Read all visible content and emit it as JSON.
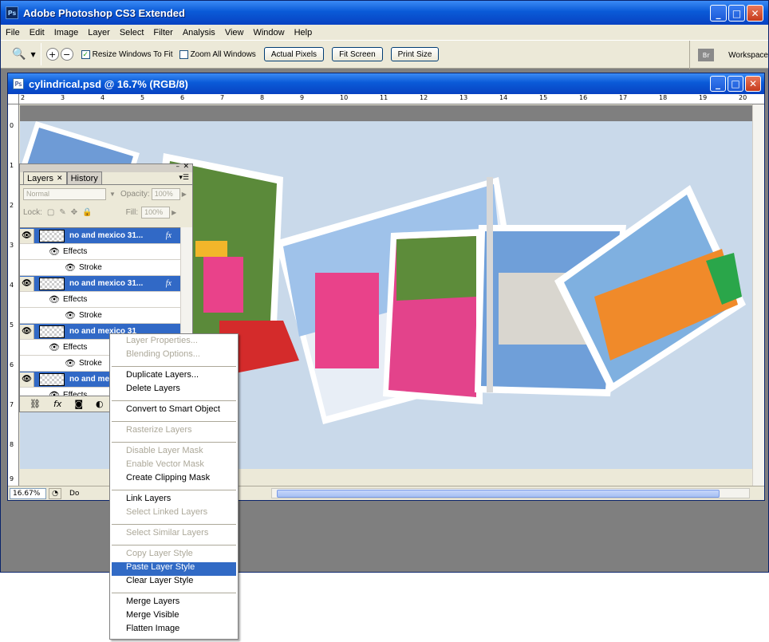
{
  "app": {
    "title": "Adobe Photoshop CS3 Extended",
    "logo": "Ps"
  },
  "menubar": [
    "File",
    "Edit",
    "Image",
    "Layer",
    "Select",
    "Filter",
    "Analysis",
    "View",
    "Window",
    "Help"
  ],
  "options": {
    "resize_label": "Resize Windows To Fit",
    "resize_checked": true,
    "zoom_all_label": "Zoom All Windows",
    "zoom_all_checked": false,
    "actual_pixels": "Actual Pixels",
    "fit_screen": "Fit Screen",
    "print_size": "Print Size",
    "workspace": "Workspace",
    "bridge_icon": "Br"
  },
  "document": {
    "title": "cylindrical.psd @ 16.7% (RGB/8)",
    "zoom": "16.67%",
    "doc_info": "Do",
    "hruler": [
      "2",
      "3",
      "4",
      "5",
      "6",
      "7",
      "8",
      "9",
      "10",
      "11",
      "12",
      "13",
      "14",
      "15",
      "16",
      "17",
      "18",
      "19",
      "20"
    ],
    "vruler": [
      "0",
      "1",
      "2",
      "3",
      "4",
      "5",
      "6",
      "7",
      "8",
      "9"
    ]
  },
  "layers_panel": {
    "tabs": [
      "Layers",
      "History"
    ],
    "blend_mode": "Normal",
    "opacity_label": "Opacity:",
    "opacity": "100%",
    "lock_label": "Lock:",
    "fill_label": "Fill:",
    "fill": "100%",
    "layer_name": "no and mexico 31...",
    "layer_name_short": "no and mexico 31",
    "effects": "Effects",
    "stroke": "Stroke",
    "fx": "fx"
  },
  "context_menu": {
    "groups": [
      [
        {
          "label": "Layer Properties...",
          "enabled": false
        },
        {
          "label": "Blending Options...",
          "enabled": false
        }
      ],
      [
        {
          "label": "Duplicate Layers...",
          "enabled": true
        },
        {
          "label": "Delete Layers",
          "enabled": true
        }
      ],
      [
        {
          "label": "Convert to Smart Object",
          "enabled": true
        }
      ],
      [
        {
          "label": "Rasterize Layers",
          "enabled": false
        }
      ],
      [
        {
          "label": "Disable Layer Mask",
          "enabled": false
        },
        {
          "label": "Enable Vector Mask",
          "enabled": false
        },
        {
          "label": "Create Clipping Mask",
          "enabled": true
        }
      ],
      [
        {
          "label": "Link Layers",
          "enabled": true
        },
        {
          "label": "Select Linked Layers",
          "enabled": false
        }
      ],
      [
        {
          "label": "Select Similar Layers",
          "enabled": false
        }
      ],
      [
        {
          "label": "Copy Layer Style",
          "enabled": false
        },
        {
          "label": "Paste Layer Style",
          "enabled": true,
          "highlighted": true
        },
        {
          "label": "Clear Layer Style",
          "enabled": true
        }
      ],
      [
        {
          "label": "Merge Layers",
          "enabled": true
        },
        {
          "label": "Merge Visible",
          "enabled": true
        },
        {
          "label": "Flatten Image",
          "enabled": true
        }
      ]
    ]
  }
}
